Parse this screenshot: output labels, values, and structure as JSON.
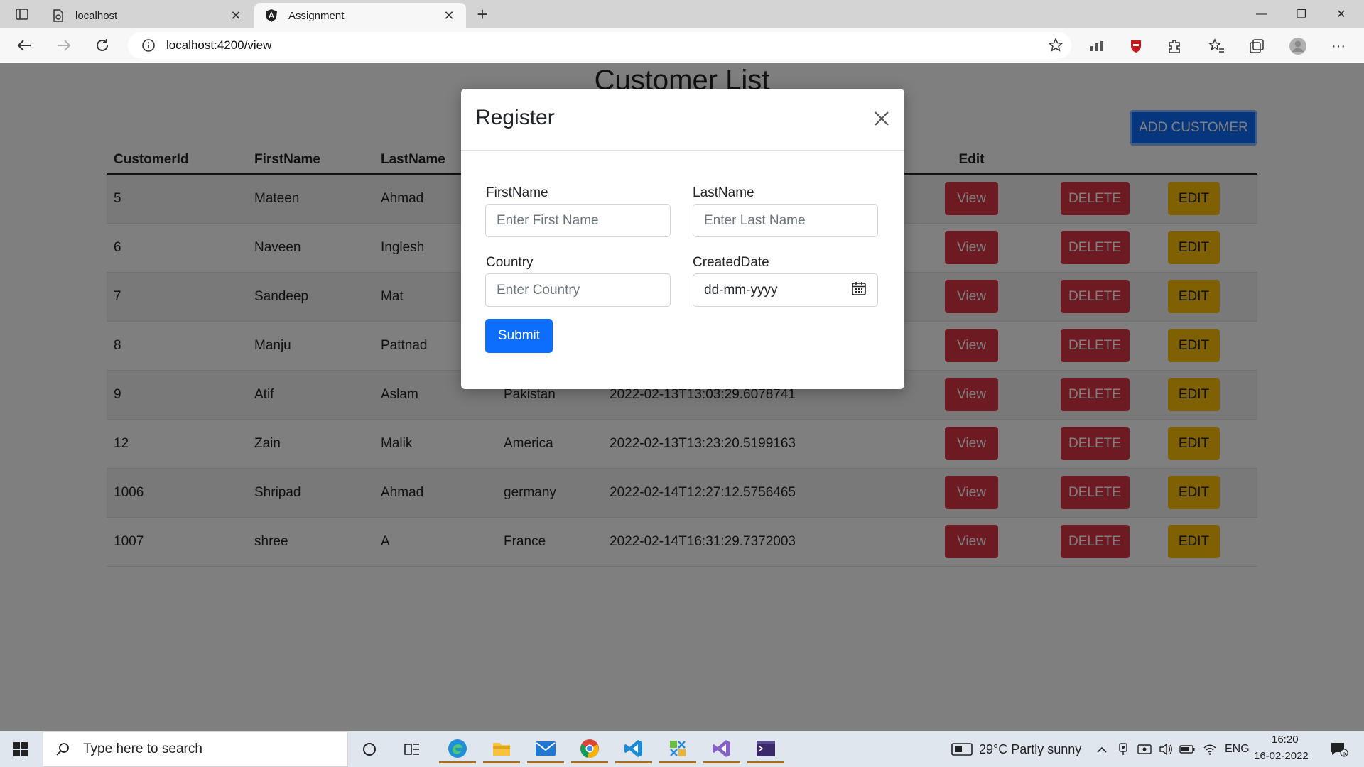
{
  "browser": {
    "tabs": [
      {
        "title": "localhost",
        "active": false
      },
      {
        "title": "Assignment",
        "active": true
      }
    ],
    "url": "localhost:4200/view",
    "new_tab": "+",
    "window_controls": {
      "minimize": "—",
      "restore": "❐",
      "close": "✕"
    },
    "menu": "···"
  },
  "page": {
    "title": "Customer List",
    "add_button": "ADD CUSTOMER",
    "columns": [
      "CustomerId",
      "FirstName",
      "LastName",
      "",
      "",
      "Edit",
      "",
      ""
    ],
    "rows": [
      {
        "id": "5",
        "first": "Mateen",
        "last": "Ahmad",
        "country": "",
        "created": ""
      },
      {
        "id": "6",
        "first": "Naveen",
        "last": "Inglesh",
        "country": "",
        "created": ""
      },
      {
        "id": "7",
        "first": "Sandeep",
        "last": "Mat",
        "country": "",
        "created": ""
      },
      {
        "id": "8",
        "first": "Manju",
        "last": "Pattnad",
        "country": "",
        "created": ""
      },
      {
        "id": "9",
        "first": "Atif",
        "last": "Aslam",
        "country": "Pakistan",
        "created": "2022-02-13T13:03:29.6078741"
      },
      {
        "id": "12",
        "first": "Zain",
        "last": "Malik",
        "country": "America",
        "created": "2022-02-13T13:23:20.5199163"
      },
      {
        "id": "1006",
        "first": "Shripad",
        "last": "Ahmad",
        "country": "germany",
        "created": "2022-02-14T12:27:12.5756465"
      },
      {
        "id": "1007",
        "first": "shree",
        "last": "A",
        "country": "France",
        "created": "2022-02-14T16:31:29.7372003"
      }
    ],
    "row_buttons": {
      "view": "View",
      "delete": "DELETE",
      "edit": "EDIT"
    },
    "colors": {
      "primary": "#0d6efd",
      "danger": "#dc3545",
      "warning": "#ffc107"
    }
  },
  "modal": {
    "title": "Register",
    "first_label": "FirstName",
    "first_placeholder": "Enter First Name",
    "last_label": "LastName",
    "last_placeholder": "Enter Last Name",
    "country_label": "Country",
    "country_placeholder": "Enter Country",
    "date_label": "CreatedDate",
    "date_placeholder": "dd-mm-yyyy",
    "submit": "Submit"
  },
  "taskbar": {
    "search_placeholder": "Type here to search",
    "weather": "29°C  Partly sunny",
    "language": "ENG",
    "time": "16:20",
    "date": "16-02-2022",
    "notifications": "5"
  }
}
